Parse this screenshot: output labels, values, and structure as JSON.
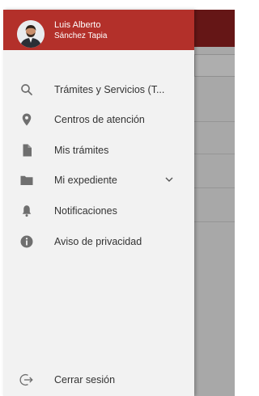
{
  "user": {
    "first_name": "Luis Alberto",
    "last_name": "Sánchez Tapia"
  },
  "menu": {
    "items": [
      {
        "label": "Trámites y Servicios (T...",
        "icon": "search-icon"
      },
      {
        "label": "Centros de atención",
        "icon": "location-pin-icon"
      },
      {
        "label": "Mis trámites",
        "icon": "document-icon"
      },
      {
        "label": "Mi expediente",
        "icon": "folder-icon",
        "expandable": true
      },
      {
        "label": "Notificaciones",
        "icon": "bell-icon"
      },
      {
        "label": "Aviso de privacidad",
        "icon": "info-icon"
      }
    ],
    "logout_label": "Cerrar sesión",
    "logout_icon": "logout-icon"
  },
  "colors": {
    "header_red": "#b3302a",
    "icon_gray": "#6f6f6f",
    "drawer_bg": "#f2f2f2"
  }
}
